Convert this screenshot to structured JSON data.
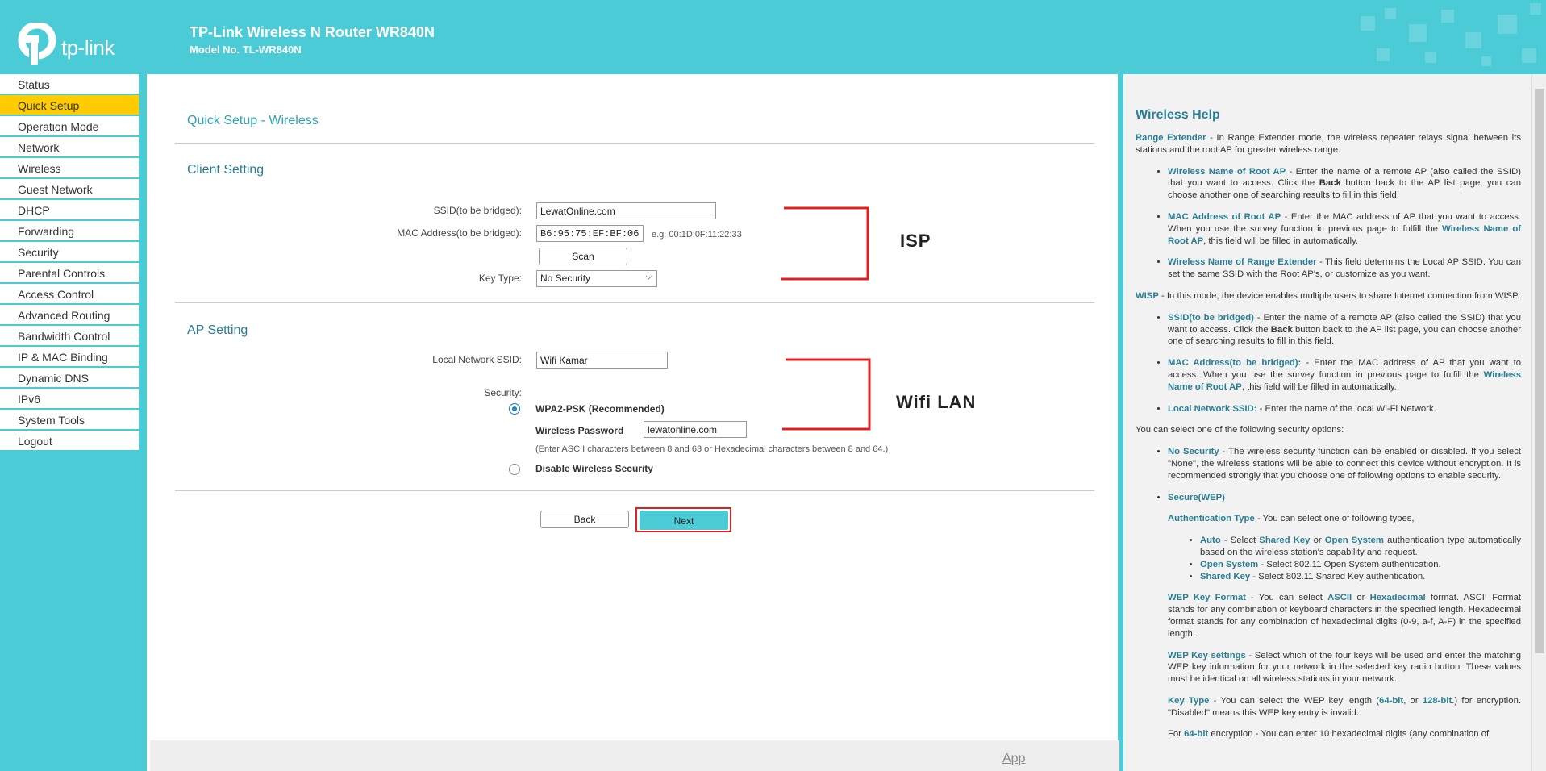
{
  "header": {
    "logo_text": "tp-link",
    "title": "TP-Link Wireless N Router WR840N",
    "model": "Model No. TL-WR840N"
  },
  "sidebar": {
    "items": [
      {
        "label": "Status"
      },
      {
        "label": "Quick Setup",
        "active": true
      },
      {
        "label": "Operation Mode"
      },
      {
        "label": "Network"
      },
      {
        "label": "Wireless"
      },
      {
        "label": "Guest Network"
      },
      {
        "label": "DHCP"
      },
      {
        "label": "Forwarding"
      },
      {
        "label": "Security"
      },
      {
        "label": "Parental Controls"
      },
      {
        "label": "Access Control"
      },
      {
        "label": "Advanced Routing"
      },
      {
        "label": "Bandwidth Control"
      },
      {
        "label": "IP & MAC Binding"
      },
      {
        "label": "Dynamic DNS"
      },
      {
        "label": "IPv6"
      },
      {
        "label": "System Tools"
      },
      {
        "label": "Logout"
      }
    ]
  },
  "main": {
    "page_title": "Quick Setup - Wireless",
    "client_setting": {
      "title": "Client Setting",
      "ssid_label": "SSID(to be bridged):",
      "ssid_value": "LewatOnline.com",
      "mac_label": "MAC Address(to be bridged):",
      "mac_value": "B6:95:75:EF:BF:06",
      "mac_hint": "e.g. 00:1D:0F:11:22:33",
      "scan_label": "Scan",
      "key_type_label": "Key Type:",
      "key_type_value": "No Security"
    },
    "ap_setting": {
      "title": "AP Setting",
      "local_ssid_label": "Local Network SSID:",
      "local_ssid_value": "Wifi Kamar",
      "security_label": "Security:",
      "wpa2_label": "WPA2-PSK (Recommended)",
      "password_label": "Wireless Password",
      "password_value": "lewatonline.com",
      "password_hint": "(Enter ASCII characters between 8 and 63 or Hexadecimal characters between 8 and 64.)",
      "disable_label": "Disable Wireless Security"
    },
    "back_label": "Back",
    "next_label": "Next",
    "annotations": {
      "isp": "ISP",
      "wifi_lan": "Wifi LAN",
      "color": "#e02020"
    },
    "app_link": "App"
  },
  "help": {
    "title": "Wireless Help",
    "range_extender_term": "Range Extender",
    "range_extender_text": " - In Range Extender mode, the wireless repeater relays signal between its stations and the root AP for greater wireless range.",
    "re_items": [
      {
        "term": "Wireless Name of Root AP",
        "pre": " - Enter the name of a remote AP (also called the SSID) that you want to access. Click the ",
        "back": "Back",
        "post": " button back to the AP list page, you can choose another one of searching results to fill in this field."
      },
      {
        "term": "MAC Address of Root AP",
        "pre": " - Enter the MAC address of AP that you want to access. When you use the survey function in previous page to fulfill the ",
        "ref": "Wireless Name of Root AP",
        "post": ", this field will be filled in automatically."
      },
      {
        "term": "Wireless Name of Range Extender",
        "pre": " - This field determins the Local AP SSID. You can set the same SSID with the Root AP's, or customize as you want."
      }
    ],
    "wisp_term": "WISP",
    "wisp_text": " - In this mode, the device enables multiple users to share Internet connection from WISP.",
    "wisp_items": [
      {
        "term": "SSID(to be bridged)",
        "pre": " - Enter the name of a remote AP (also called the SSID) that you want to access. Click the ",
        "back": "Back",
        "post": " button back to the AP list page, you can choose another one of searching results to fill in this field."
      },
      {
        "term": "MAC Address(to be bridged):",
        "pre": " - Enter the MAC address of AP that you want to access. When you use the survey function in previous page to fulfill the ",
        "ref": "Wireless Name of Root AP",
        "post": ", this field will be filled in automatically."
      },
      {
        "term": "Local Network SSID:",
        "pre": " - Enter the name of the local Wi-Fi Network."
      }
    ],
    "options_intro": "You can select one of the following security options:",
    "no_security_term": "No Security",
    "no_security_text": " - The wireless security function can be enabled or disabled. If you select \"None\", the wireless stations will be able to connect this device without encryption. It is recommended strongly that you choose one of following options to enable security.",
    "wep_term": "Secure(WEP)",
    "auth_type_term": "Authentication Type",
    "auth_type_text": " - You can select one of following types,",
    "auto_term": "Auto",
    "auto_text_1": " - Select ",
    "auto_shared": "Shared Key",
    "auto_or": " or ",
    "auto_open": "Open System",
    "auto_text_2": " authentication type automatically based on the wireless station's capability and request.",
    "open_term": "Open System",
    "open_text": " - Select 802.11 Open System authentication.",
    "shared_term": "Shared Key",
    "shared_text": " - Select 802.11 Shared Key authentication.",
    "wep_format_term": "WEP Key Format",
    "wep_format_text_1": " - You can select ",
    "wep_format_ascii": "ASCII",
    "wep_format_or": " or ",
    "wep_format_hex": "Hexadecimal",
    "wep_format_text_2": " format. ASCII Format stands for any combination of keyboard characters in the specified length. Hexadecimal format stands for any combination of hexadecimal digits (0-9, a-f, A-F) in the specified length.",
    "wep_settings_term": "WEP Key settings",
    "wep_settings_text": " - Select which of the four keys will be used and enter the matching WEP key information for your network in the selected key radio button. These values must be identical on all wireless stations in your network.",
    "key_type_term": "Key Type",
    "key_type_text_1": " - You can select the WEP key length (",
    "key_type_64": "64-bit",
    "key_type_comma": ", or ",
    "key_type_128": "128-bit",
    "key_type_text_2": ".) for encryption. \"Disabled\" means this WEP key entry is invalid.",
    "for64_pre": "For ",
    "for64_term": "64-bit",
    "for64_text": " encryption - You can enter 10 hexadecimal digits (any combination of"
  }
}
